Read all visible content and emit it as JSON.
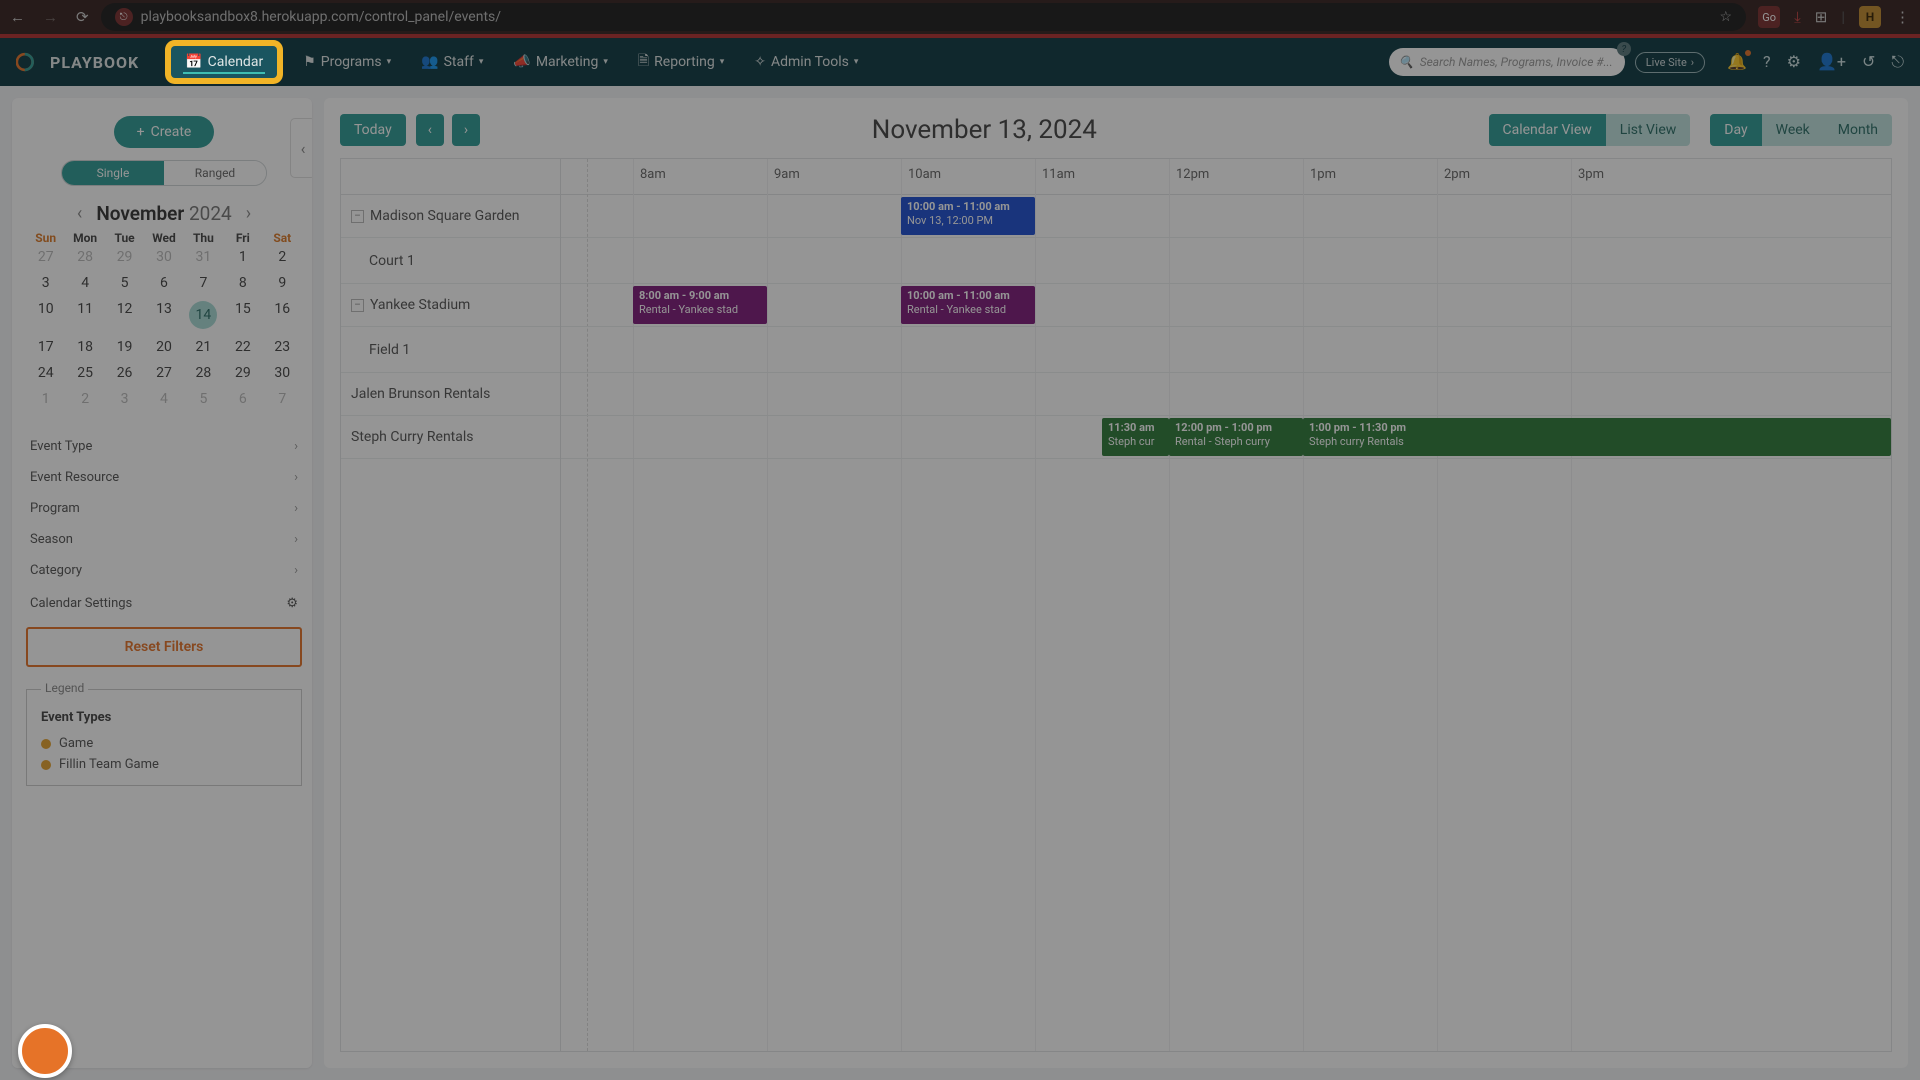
{
  "browser": {
    "url": "playbooksandbox8.herokuapp.com/control_panel/events/",
    "avatar_letter": "H",
    "ext_label": "Go"
  },
  "logo_text": "PLAYBOOK",
  "nav": {
    "calendar": "Calendar",
    "programs": "Programs",
    "staff": "Staff",
    "marketing": "Marketing",
    "reporting": "Reporting",
    "admin": "Admin Tools"
  },
  "search_placeholder": "Search Names, Programs, Invoice #...",
  "live_site": "Live Site",
  "sidebar": {
    "create": "Create",
    "seg": {
      "single": "Single",
      "ranged": "Ranged"
    },
    "month": "November",
    "year": "2024",
    "dow": [
      "Sun",
      "Mon",
      "Tue",
      "Wed",
      "Thu",
      "Fri",
      "Sat"
    ],
    "days_prev": [
      "27",
      "28",
      "29",
      "30",
      "31"
    ],
    "days": [
      "1",
      "2",
      "3",
      "4",
      "5",
      "6",
      "7",
      "8",
      "9",
      "10",
      "11",
      "12",
      "13",
      "14",
      "15",
      "16",
      "17",
      "18",
      "19",
      "20",
      "21",
      "22",
      "23",
      "24",
      "25",
      "26",
      "27",
      "28",
      "29",
      "30"
    ],
    "days_next": [
      "1",
      "2",
      "3",
      "4",
      "5",
      "6",
      "7"
    ],
    "today_day": "14",
    "filters": [
      "Event Type",
      "Event Resource",
      "Program",
      "Season",
      "Category"
    ],
    "cal_settings": "Calendar Settings",
    "reset": "Reset Filters",
    "legend": {
      "label": "Legend",
      "head": "Event Types",
      "items": [
        {
          "name": "Game",
          "color": "#e6a32e"
        },
        {
          "name": "Fillin Team Game",
          "color": "#e6a32e"
        }
      ]
    }
  },
  "calendar": {
    "today": "Today",
    "date_title": "November 13, 2024",
    "views": {
      "calendar": "Calendar View",
      "list": "List View"
    },
    "ranges": {
      "day": "Day",
      "week": "Week",
      "month": "Month"
    },
    "time_labels": [
      "",
      "8am",
      "9am",
      "10am",
      "11am",
      "12pm",
      "1pm",
      "2pm",
      "3pm"
    ],
    "resources": [
      {
        "name": "Madison Square Garden",
        "expandable": true
      },
      {
        "name": "Court 1",
        "sub": true
      },
      {
        "name": "Yankee Stadium",
        "expandable": true
      },
      {
        "name": "Field 1",
        "sub": true
      },
      {
        "name": "Jalen Brunson Rentals"
      },
      {
        "name": "Steph Curry Rentals"
      }
    ],
    "events": {
      "msg": {
        "time": "10:00 am - 11:00 am",
        "sub": "Nov 13, 12:00 PM",
        "color": "#1e4fd1"
      },
      "ys1": {
        "time": "8:00 am - 9:00 am",
        "sub": "Rental - Yankee stad",
        "color": "#7e1a7a"
      },
      "ys2": {
        "time": "10:00 am - 11:00 am",
        "sub": "Rental - Yankee stad",
        "color": "#7e1a7a"
      },
      "sc1": {
        "time": "11:30 am",
        "sub": "Steph cur",
        "color": "#2e7a3a"
      },
      "sc2": {
        "time": "12:00 pm - 1:00 pm",
        "sub": "Rental - Steph curry",
        "color": "#2e7a3a"
      },
      "sc3": {
        "time": "1:00 pm - 11:30 pm",
        "sub": "Steph curry Rentals",
        "color": "#2e7a3a"
      }
    }
  }
}
